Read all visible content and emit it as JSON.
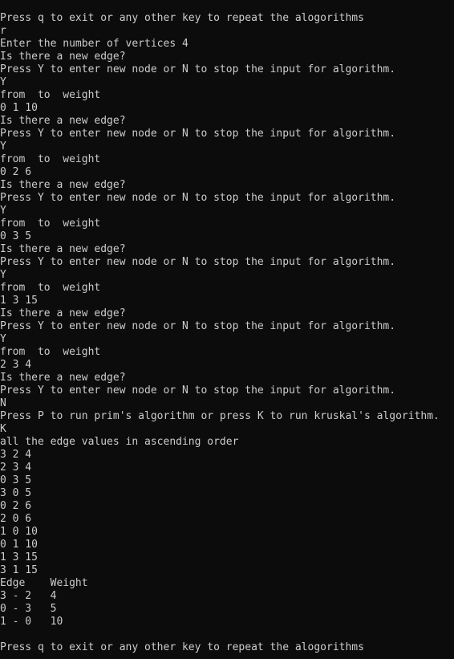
{
  "console": {
    "lines": [
      "Press q to exit or any other key to repeat the alogorithms",
      "r",
      "Enter the number of vertices 4",
      "Is there a new edge?",
      "Press Y to enter new node or N to stop the input for algorithm.",
      "Y",
      "from  to  weight",
      "0 1 10",
      "Is there a new edge?",
      "Press Y to enter new node or N to stop the input for algorithm.",
      "Y",
      "from  to  weight",
      "0 2 6",
      "Is there a new edge?",
      "Press Y to enter new node or N to stop the input for algorithm.",
      "Y",
      "from  to  weight",
      "0 3 5",
      "Is there a new edge?",
      "Press Y to enter new node or N to stop the input for algorithm.",
      "Y",
      "from  to  weight",
      "1 3 15",
      "Is there a new edge?",
      "Press Y to enter new node or N to stop the input for algorithm.",
      "Y",
      "from  to  weight",
      "2 3 4",
      "Is there a new edge?",
      "Press Y to enter new node or N to stop the input for algorithm.",
      "N",
      "Press P to run prim's algorithm or press K to run kruskal's algorithm.",
      "K",
      "all the edge values in ascending order",
      "3 2 4",
      "2 3 4",
      "0 3 5",
      "3 0 5",
      "0 2 6",
      "2 0 6",
      "1 0 10",
      "0 1 10",
      "1 3 15",
      "3 1 15",
      "Edge    Weight",
      "3 - 2   4",
      "0 - 3   5",
      "1 - 0   10",
      "",
      "Press q to exit or any other key to repeat the alogorithms"
    ]
  },
  "colors": {
    "background": "#0c0c0c",
    "text": "#cccccc"
  }
}
